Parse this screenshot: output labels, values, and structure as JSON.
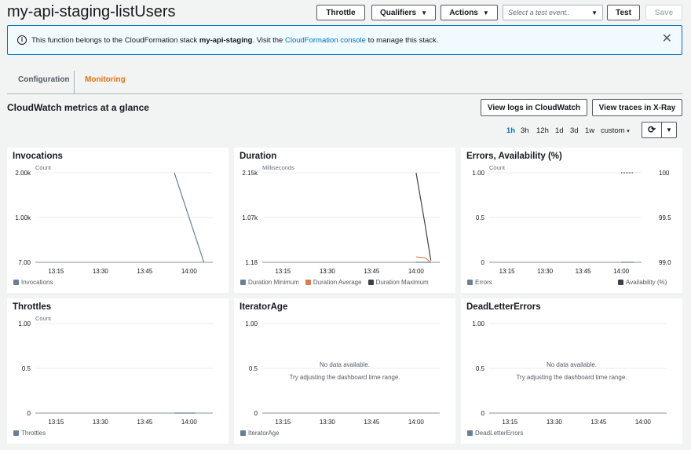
{
  "header": {
    "title": "my-api-staging-listUsers",
    "throttle_label": "Throttle",
    "qualifiers_label": "Qualifiers",
    "actions_label": "Actions",
    "test_event_placeholder": "Select a test event..",
    "test_label": "Test",
    "save_label": "Save"
  },
  "banner": {
    "part1": "This function belongs to the CloudFormation stack ",
    "stack": "my-api-staging",
    "part2": ". Visit the ",
    "link": "CloudFormation console",
    "part3": " to manage this stack."
  },
  "tabs": [
    {
      "label": "Configuration",
      "active": false
    },
    {
      "label": "Monitoring",
      "active": true
    }
  ],
  "section": {
    "title": "CloudWatch metrics at a glance",
    "logs_button": "View logs in CloudWatch",
    "traces_button": "View traces in X-Ray"
  },
  "time_ranges": [
    {
      "label": "1h",
      "active": true
    },
    {
      "label": "3h",
      "active": false
    },
    {
      "label": "12h",
      "active": false
    },
    {
      "label": "1d",
      "active": false
    },
    {
      "label": "3d",
      "active": false
    },
    {
      "label": "1w",
      "active": false
    },
    {
      "label": "custom",
      "active": false
    }
  ],
  "icons": {
    "info": "info-circle-icon",
    "close": "close-icon",
    "refresh": "refresh-icon",
    "caret": "caret-down-icon"
  },
  "colors": {
    "accent": "#ec7211",
    "link": "#0073bb",
    "series_blue": "#687f9a",
    "series_orange": "#d97c4a",
    "series_dark": "#3c4048"
  },
  "no_data": {
    "line1": "No data available.",
    "line2": "Try adjusting the dashboard time range."
  },
  "chart_data": [
    {
      "type": "line",
      "title": "Invocations",
      "unit_label": "Count",
      "x_ticks": [
        "13:15",
        "13:30",
        "13:45",
        "14:00"
      ],
      "y_ticks": [
        "2.00k",
        "1.00k",
        "7.00"
      ],
      "ylim": [
        7,
        2000
      ],
      "series": [
        {
          "name": "Invocations",
          "color": "#687f9a",
          "points": [
            [
              "13:55",
              2000
            ],
            [
              "14:05",
              7
            ]
          ]
        }
      ],
      "legend": "bottom-left"
    },
    {
      "type": "line",
      "title": "Duration",
      "unit_label": "Milliseconds",
      "x_ticks": [
        "13:15",
        "13:30",
        "13:45",
        "14:00"
      ],
      "y_ticks": [
        "2.15k",
        "1.07k",
        "1.18"
      ],
      "ylim": [
        1.18,
        2150
      ],
      "series": [
        {
          "name": "Duration Minimum",
          "color": "#687f9a",
          "points": [
            [
              "14:00",
              1.18
            ],
            [
              "14:05",
              1.18
            ]
          ]
        },
        {
          "name": "Duration Average",
          "color": "#d97c4a",
          "points": [
            [
              "14:00",
              130
            ],
            [
              "14:03",
              110
            ],
            [
              "14:05",
              1.18
            ]
          ]
        },
        {
          "name": "Duration Maximum",
          "color": "#3c4048",
          "points": [
            [
              "14:00",
              2150
            ],
            [
              "14:03",
              920
            ],
            [
              "14:05",
              45
            ]
          ]
        }
      ],
      "legend": "bottom-left"
    },
    {
      "type": "line",
      "title": "Errors, Availability (%)",
      "unit_label": "Count",
      "x_ticks": [
        "13:15",
        "13:30",
        "13:45",
        "14:00"
      ],
      "y_ticks": [
        "1.00",
        "0.5",
        "0"
      ],
      "y2_ticks": [
        "100",
        "99.5",
        "99.0"
      ],
      "ylim": [
        0,
        1
      ],
      "y2lim": [
        99,
        100
      ],
      "series": [
        {
          "name": "Errors",
          "color": "#687f9a",
          "axis": "left",
          "points": [
            [
              "14:00",
              0
            ],
            [
              "14:05",
              0
            ]
          ]
        },
        {
          "name": "Availability (%)",
          "color": "#3c4048",
          "axis": "right",
          "points": [
            [
              "14:00",
              100
            ],
            [
              "14:05",
              100
            ]
          ]
        }
      ],
      "legend": "bottom"
    },
    {
      "type": "line",
      "title": "Throttles",
      "unit_label": "Count",
      "x_ticks": [
        "13:15",
        "13:30",
        "13:45",
        "14:00"
      ],
      "y_ticks": [
        "1.00",
        "0.5",
        "0"
      ],
      "ylim": [
        0,
        1
      ],
      "series": [
        {
          "name": "Throttles",
          "color": "#687f9a",
          "points": [
            [
              "13:55",
              0
            ],
            [
              "14:02",
              0
            ]
          ]
        }
      ],
      "legend": "bottom-left"
    },
    {
      "type": "line",
      "title": "IteratorAge",
      "x_ticks": [
        "13:15",
        "13:30",
        "13:45",
        "14:00"
      ],
      "y_ticks": [
        "1.00",
        "0.5",
        "0"
      ],
      "ylim": [
        0,
        1
      ],
      "series": [
        {
          "name": "IteratorAge",
          "color": "#687f9a",
          "points": []
        }
      ],
      "no_data": true,
      "legend": "bottom-left"
    },
    {
      "type": "line",
      "title": "DeadLetterErrors",
      "x_ticks": [
        "13:15",
        "13:30",
        "13:45",
        "14:00"
      ],
      "y_ticks": [
        "1.00",
        "0.5",
        "0"
      ],
      "ylim": [
        0,
        1
      ],
      "series": [
        {
          "name": "DeadLetterErrors",
          "color": "#687f9a",
          "points": []
        }
      ],
      "no_data": true,
      "legend": "bottom-left"
    }
  ]
}
